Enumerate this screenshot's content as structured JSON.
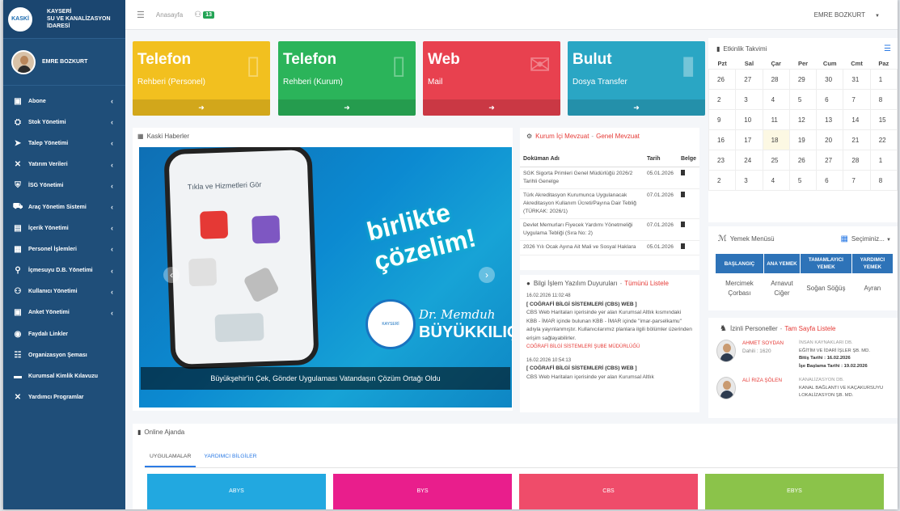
{
  "brand": {
    "logo_text": "KASKİ",
    "line1": "KAYSERİ",
    "line2": "SU VE KANALİZASYON",
    "line3": "İDARESİ"
  },
  "user": {
    "name": "EMRE BOZKURT"
  },
  "sidebar": {
    "items": [
      {
        "label": "Abone",
        "icon": "user-icon",
        "caret": "‹"
      },
      {
        "label": "Stok Yönetimi",
        "icon": "cubes-icon",
        "caret": "‹"
      },
      {
        "label": "Talep Yönetimi",
        "icon": "send-icon",
        "caret": "‹"
      },
      {
        "label": "Yatırım Verileri",
        "icon": "tools-icon",
        "caret": "‹"
      },
      {
        "label": "İSG Yönetimi",
        "icon": "shield-icon",
        "caret": "‹"
      },
      {
        "label": "Araç Yönetim Sistemi",
        "icon": "car-icon",
        "caret": "‹"
      },
      {
        "label": "İçerik Yönetimi",
        "icon": "file-icon",
        "caret": "‹"
      },
      {
        "label": "Personel İşlemleri",
        "icon": "id-card-icon",
        "caret": "‹"
      },
      {
        "label": "İçmesuyu D.B. Yönetimi",
        "icon": "faucet-icon",
        "caret": "‹"
      },
      {
        "label": "Kullanıcı Yönetimi",
        "icon": "users-icon",
        "caret": "‹"
      },
      {
        "label": "Anket Yönetimi",
        "icon": "survey-icon",
        "caret": "‹"
      },
      {
        "label": "Faydalı Linkler",
        "icon": "globe-icon",
        "caret": ""
      },
      {
        "label": "Organizasyon Şeması",
        "icon": "sitemap-icon",
        "caret": ""
      },
      {
        "label": "Kurumsal Kimlik Kılavuzu",
        "icon": "book-icon",
        "caret": ""
      },
      {
        "label": "Yardımcı Programlar",
        "icon": "tools-icon",
        "caret": ""
      }
    ]
  },
  "topbar": {
    "home": "Anasayfa",
    "badge": "13",
    "user": "EMRE BOZKURT",
    "user_caret": "▼"
  },
  "tiles": [
    {
      "title": "Telefon",
      "subtitle": "Rehberi (Personel)",
      "color": "#f2c01f",
      "icon": "phone-icon"
    },
    {
      "title": "Telefon",
      "subtitle": "Rehberi (Kurum)",
      "color": "#2bb45a",
      "icon": "phone-icon"
    },
    {
      "title": "Web",
      "subtitle": "Mail",
      "color": "#e8414f",
      "icon": "envelope-icon"
    },
    {
      "title": "Bulut",
      "subtitle": "Dosya Transfer",
      "color": "#2aa6c4",
      "icon": "file-icon"
    }
  ],
  "news": {
    "heading": "Kaski Haberler",
    "caption": "Büyükşehir'in Çek, Gönder Uygulaması Vatandaşın Çözüm Ortağı Oldu",
    "phone_title": "Tıkla ve Hizmetleri Gör",
    "slogan1": "birlikte",
    "slogan2": "çözelim!",
    "sig": "Dr. Memduh",
    "sname": "BÜYÜKKILIÇ"
  },
  "docs": {
    "tab1": "Kurum İçi Mevzuat",
    "sep": "-",
    "tab2": "Genel Mevzuat",
    "col_name": "Doküman Adı",
    "col_date": "Tarih",
    "col_doc": "Belge",
    "rows": [
      {
        "name": "SGK Sigorta Primleri Genel Müdürlüğü 2026/2 Tarihli Genelge",
        "date": "05.01.2026"
      },
      {
        "name": "Türk Akreditasyon Kurumunca Uygulanacak Akreditasyon Kullanım Ücreti/Payına Dair Tebliğ (TÜRKAK: 2026/1)",
        "date": "07.01.2026"
      },
      {
        "name": "Devlet Memurları Fiyecek Yardımı Yönetmeliği Uygulama Tebliği (Sıra No: 2)",
        "date": "07.01.2026"
      },
      {
        "name": "2026 Yılı Ocak Ayına Ait Mali ve Sosyal Haklara",
        "date": "05.01.2026"
      }
    ]
  },
  "ann": {
    "title": "Bilgi İşlem Yazılım Duyuruları",
    "sep": "-",
    "link": "Tümünü Listele",
    "items": [
      {
        "date": "16.02.2026 11:02:48",
        "title": "[ COĞRAFİ BİLGİ SİSTEMLERİ (CBS) WEB ]",
        "body": "CBS Web Haritaları içerisinde yer alan Kurumsal Altlık kısmındaki KBB - İMAR içinde bulunan KBB - İMAR içinde \"imar-parselkamu\" adıyla yayınlanmıştır. Kullanıcılarımız planlara ilgili bölümler üzerinden erişim sağlayabilirler.",
        "source": "COĞRAFİ BİLGİ SİSTEMLERİ ŞUBE MÜDÜRLÜĞÜ"
      },
      {
        "date": "16.02.2026 10:54:13",
        "title": "[ COĞRAFİ BİLGİ SİSTEMLERİ (CBS) WEB ]",
        "body": "CBS Web Haritaları içerisinde yer alan Kurumsal Altlık",
        "source": ""
      }
    ]
  },
  "cal": {
    "title": "Etkinlik Takvimi",
    "days": [
      "Pzt",
      "Sal",
      "Çar",
      "Per",
      "Cum",
      "Cmt",
      "Paz"
    ],
    "weeks": [
      [
        "26",
        "27",
        "28",
        "29",
        "30",
        "31",
        "1"
      ],
      [
        "2",
        "3",
        "4",
        "5",
        "6",
        "7",
        "8"
      ],
      [
        "9",
        "10",
        "11",
        "12",
        "13",
        "14",
        "15"
      ],
      [
        "16",
        "17",
        "18",
        "19",
        "20",
        "21",
        "22"
      ],
      [
        "23",
        "24",
        "25",
        "26",
        "27",
        "28",
        "1"
      ],
      [
        "2",
        "3",
        "4",
        "5",
        "6",
        "7",
        "8"
      ]
    ]
  },
  "menu": {
    "title": "Yemek Menüsü",
    "select": "Seçiminiz...",
    "heads": [
      "BAŞLANGIÇ",
      "ANA YEMEK",
      "TAMAMLAYICI YEMEK",
      "YARDIMCI YEMEK"
    ],
    "items": [
      "Mercimek Çorbası",
      "Arnavut Ciğer",
      "Soğan Söğüş",
      "Ayran"
    ]
  },
  "leave": {
    "title": "İzinli Personeller",
    "sep": "-",
    "link": "Tam Sayfa Listele",
    "people": [
      {
        "name": "AHMET SOYDAN",
        "sub": "Dahili : 1620",
        "dept": "İNSAN KAYNAKLARI DB.",
        "unit": "EĞİTİM VE İDARİ İŞLER ŞB. MD.",
        "start_label": "Bitiş Tarihi :",
        "start": "16.02.2026",
        "end_label": "İşe Başlama Tarihi :",
        "end": "19.02.2026"
      },
      {
        "name": "ALİ RIZA ŞÖLEN",
        "sub": "",
        "dept": "KANALİZASYON DB.",
        "unit": "KANAL BAĞLANTI VE KAÇAKURSUYU",
        "start_label": "",
        "start": "",
        "end_label": "",
        "end": "LOKALİZASYON ŞB. MD."
      }
    ]
  },
  "agenda": {
    "title": "Online Ajanda",
    "tab1": "UYGULAMALAR",
    "tab2": "YARDIMCI BİLGİLER",
    "apps": [
      {
        "label": "ABYS",
        "color": "#22a8e0"
      },
      {
        "label": "BYS",
        "color": "#e91e8c"
      },
      {
        "label": "CBS",
        "color": "#ef4c6a"
      },
      {
        "label": "EBYS",
        "color": "#8bc34a"
      }
    ]
  }
}
